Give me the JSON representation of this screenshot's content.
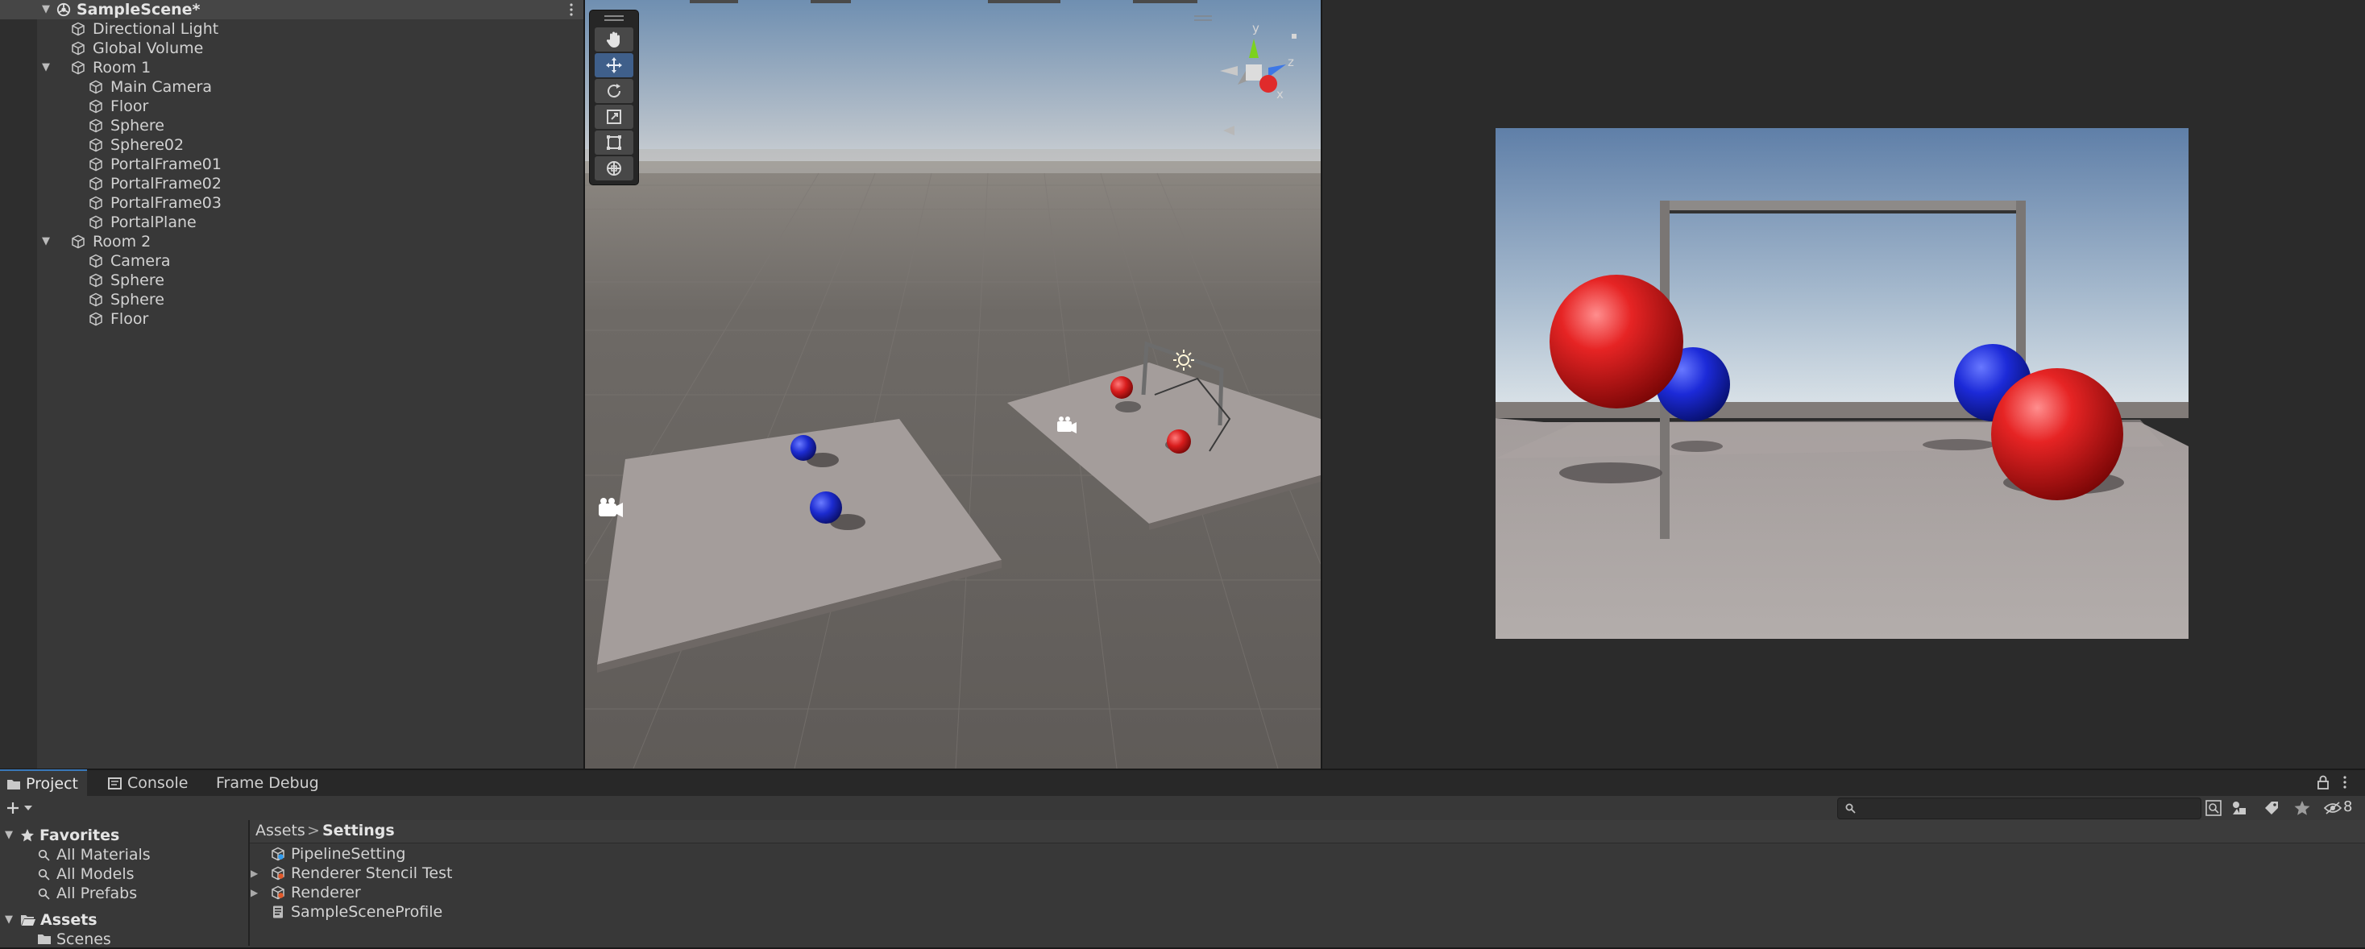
{
  "hierarchy": {
    "scene_name": "SampleScene*",
    "items": [
      {
        "label": "Directional Light",
        "depth": 1,
        "foldout": false
      },
      {
        "label": "Global Volume",
        "depth": 1,
        "foldout": false
      },
      {
        "label": "Room 1",
        "depth": 1,
        "foldout": true
      },
      {
        "label": "Main Camera",
        "depth": 2,
        "foldout": false
      },
      {
        "label": "Floor",
        "depth": 2,
        "foldout": false
      },
      {
        "label": "Sphere",
        "depth": 2,
        "foldout": false
      },
      {
        "label": "Sphere02",
        "depth": 2,
        "foldout": false
      },
      {
        "label": "PortalFrame01",
        "depth": 2,
        "foldout": false
      },
      {
        "label": "PortalFrame02",
        "depth": 2,
        "foldout": false
      },
      {
        "label": "PortalFrame03",
        "depth": 2,
        "foldout": false
      },
      {
        "label": "PortalPlane",
        "depth": 2,
        "foldout": false
      },
      {
        "label": "Room 2",
        "depth": 1,
        "foldout": true
      },
      {
        "label": "Camera",
        "depth": 2,
        "foldout": false
      },
      {
        "label": "Sphere",
        "depth": 2,
        "foldout": false
      },
      {
        "label": "Sphere",
        "depth": 2,
        "foldout": false
      },
      {
        "label": "Floor",
        "depth": 2,
        "foldout": false
      }
    ]
  },
  "scene_view": {
    "gizmo": {
      "y_label": "y",
      "x_label": "x",
      "z_label": "z"
    },
    "tools": [
      "hand-tool",
      "move-tool",
      "rotate-tool",
      "scale-tool",
      "rect-tool",
      "transform-tool"
    ],
    "active_tool": "move-tool"
  },
  "bottom_panel": {
    "tabs": [
      {
        "label": "Project",
        "icon": "folder-icon",
        "active": true
      },
      {
        "label": "Console",
        "icon": "console-icon",
        "active": false
      },
      {
        "label": "Frame Debug",
        "icon": "",
        "active": false
      }
    ],
    "search": {
      "placeholder": "",
      "value": ""
    },
    "hidden_count": "8",
    "favorites": {
      "label": "Favorites",
      "items": [
        "All Materials",
        "All Models",
        "All Prefabs"
      ]
    },
    "assets_root": {
      "label": "Assets",
      "children": [
        "Scenes"
      ]
    },
    "breadcrumb": {
      "root": "Assets",
      "separator": ">",
      "current": "Settings"
    },
    "files": [
      {
        "label": "PipelineSetting",
        "icon": "pipeline-asset-icon",
        "expandable": false
      },
      {
        "label": "Renderer Stencil Test",
        "icon": "renderer-asset-icon",
        "expandable": true
      },
      {
        "label": "Renderer",
        "icon": "renderer-asset-icon",
        "expandable": true
      },
      {
        "label": "SampleSceneProfile",
        "icon": "profile-asset-icon",
        "expandable": false
      }
    ]
  },
  "colors": {
    "panel": "#383838",
    "accent": "#3a79bb",
    "sphere_red": "#d81c1c",
    "sphere_blue": "#1c2bd0"
  }
}
